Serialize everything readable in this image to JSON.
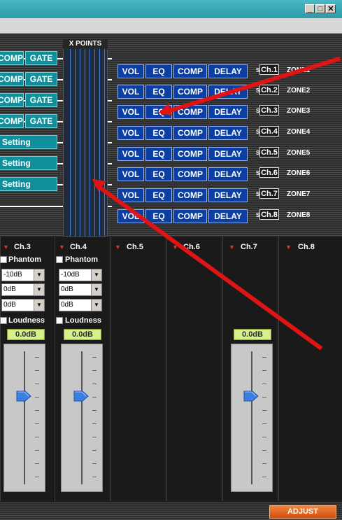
{
  "window": {
    "minimize": "_",
    "restore": "□",
    "close": "✕"
  },
  "xpoints": {
    "title": "X POINTS"
  },
  "inputs": [
    {
      "comp": "COMP",
      "gate": "GATE"
    },
    {
      "comp": "COMP",
      "gate": "GATE"
    },
    {
      "comp": "COMP",
      "gate": "GATE"
    },
    {
      "comp": "COMP",
      "gate": "GATE"
    }
  ],
  "settings": [
    "Setting",
    "Setting",
    "Setting"
  ],
  "zones": [
    {
      "vol": "VOL",
      "eq": "EQ",
      "comp": "COMP",
      "delay": "DELAY",
      "ch": "Ch.1",
      "zone": "ZONE1"
    },
    {
      "vol": "VOL",
      "eq": "EQ",
      "comp": "COMP",
      "delay": "DELAY",
      "ch": "Ch.2",
      "zone": "ZONE2"
    },
    {
      "vol": "VOL",
      "eq": "EQ",
      "comp": "COMP",
      "delay": "DELAY",
      "ch": "Ch.3",
      "zone": "ZONE3"
    },
    {
      "vol": "VOL",
      "eq": "EQ",
      "comp": "COMP",
      "delay": "DELAY",
      "ch": "Ch.4",
      "zone": "ZONE4"
    },
    {
      "vol": "VOL",
      "eq": "EQ",
      "comp": "COMP",
      "delay": "DELAY",
      "ch": "Ch.5",
      "zone": "ZONE5"
    },
    {
      "vol": "VOL",
      "eq": "EQ",
      "comp": "COMP",
      "delay": "DELAY",
      "ch": "Ch.6",
      "zone": "ZONE6"
    },
    {
      "vol": "VOL",
      "eq": "EQ",
      "comp": "COMP",
      "delay": "DELAY",
      "ch": "Ch.7",
      "zone": "ZONE7"
    },
    {
      "vol": "VOL",
      "eq": "EQ",
      "comp": "COMP",
      "delay": "DELAY",
      "ch": "Ch.8",
      "zone": "ZONE8"
    }
  ],
  "zone_s_icon": "S",
  "strips": [
    {
      "label": "Ch.3",
      "phantom": "Phantom",
      "sel1": "-10dB",
      "sel2": "0dB",
      "sel3": "0dB",
      "loudness": "Loudness",
      "gain": "0.0dB",
      "level": 0.7
    },
    {
      "label": "Ch.4",
      "phantom": "Phantom",
      "sel1": "-10dB",
      "sel2": "0dB",
      "sel3": "0dB",
      "loudness": "Loudness",
      "gain": "0.0dB",
      "level": 0.7
    },
    {
      "label": "Ch.5"
    },
    {
      "label": "Ch.6"
    },
    {
      "label": "Ch.7",
      "gain": "0.0dB",
      "level": 0.7
    },
    {
      "label": "Ch.8"
    }
  ],
  "adjust": "ADJUST",
  "colors": {
    "title_bar": "#2c9aa8",
    "input_button": "#0f8f9c",
    "zone_button": "#0b3fa3",
    "adjust": "#e0601c",
    "arrow": "#e01414",
    "gain": "#d8f08a"
  },
  "icons": {
    "dropdown": "chevron-down-icon",
    "fader_knob": "fader-knob-icon",
    "channel_menu": "triangle-down-icon"
  }
}
